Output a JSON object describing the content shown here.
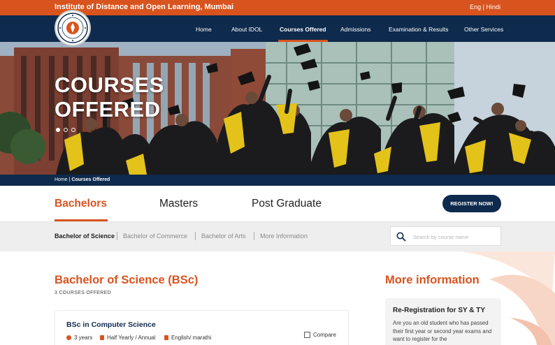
{
  "topbar": {
    "title": "Institute of Distance and Open Learning, Mumbai",
    "lang_en": "Eng",
    "lang_sep": "|",
    "lang_hi": "Hindi",
    "color": "#d9531e"
  },
  "nav": {
    "items": [
      "Home",
      "About IDOL",
      "Courses Offered",
      "Admissions",
      "Examination & Results",
      "Other Services"
    ],
    "active": "Courses Offered",
    "color": "#0e2a4d"
  },
  "hero": {
    "title_line1": "COURSES",
    "title_line2": "OFFERED",
    "slides": 3,
    "active_slide": 1
  },
  "breadcrumb": {
    "home": "Home",
    "separator": "|",
    "current": "Courses Offered"
  },
  "tabs": {
    "items": [
      "Bachelors",
      "Masters",
      "Post Graduate"
    ],
    "active": "Bachelors",
    "register_label": "REGISTER NOW!"
  },
  "subtabs": {
    "items": [
      "Bachelor of Science",
      "Bachelor of Commerce",
      "Bachelor of Arts",
      "More Information"
    ],
    "active": "Bachelor of Science",
    "search_placeholder": "Search by course name"
  },
  "program": {
    "title": "Bachelor of Science (BSc)",
    "count_label": "3 COURSES OFFERED",
    "courses": [
      {
        "name": "BSc in Computer Science",
        "duration": "3 years",
        "exam_pattern": "Half Yearly / Annual",
        "medium": "English/ marathi",
        "compare_label": "Compare"
      }
    ]
  },
  "more_info": {
    "heading": "More information",
    "card_title": "Re-Registration for SY & TY",
    "card_text": "Are you an old student who has passed their first year or second year exams and want to register for the"
  }
}
